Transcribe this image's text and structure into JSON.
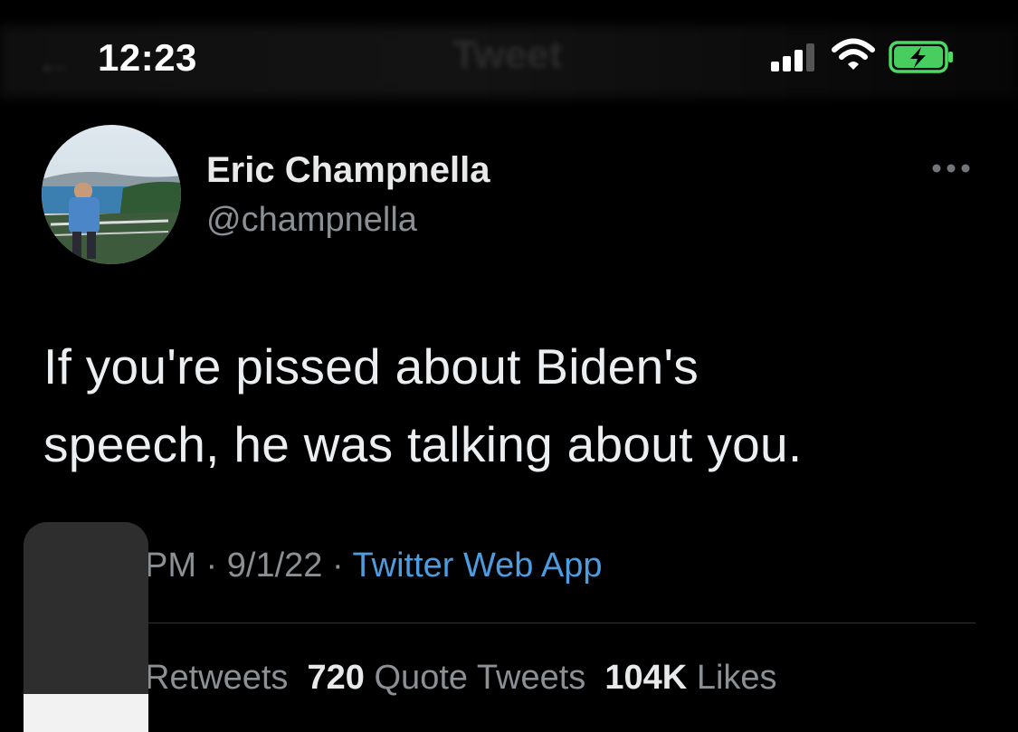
{
  "status_bar": {
    "time": "12:23",
    "signal_icon": "cellular-signal-icon",
    "wifi_icon": "wifi-icon",
    "battery_icon": "battery-charging-icon",
    "battery_color": "#4cd964"
  },
  "nav": {
    "title": "Tweet",
    "back_icon": "back-arrow-icon"
  },
  "tweet": {
    "display_name": "Eric Champnella",
    "handle": "@champnella",
    "more_icon": "more-options-icon",
    "text_line1": "If you're pissed about Biden's",
    "text_line2": "speech, he was talking about you.",
    "time_fragment": "PM",
    "sep1": " · ",
    "date": "9/1/22",
    "sep2": " · ",
    "source": "Twitter Web App",
    "source_color": "#4d9ce0",
    "stats": {
      "retweets_label": "Retweets",
      "quote_tweets_count": "720",
      "quote_tweets_label": "Quote Tweets",
      "likes_count": "104K",
      "likes_label": "Likes"
    }
  }
}
